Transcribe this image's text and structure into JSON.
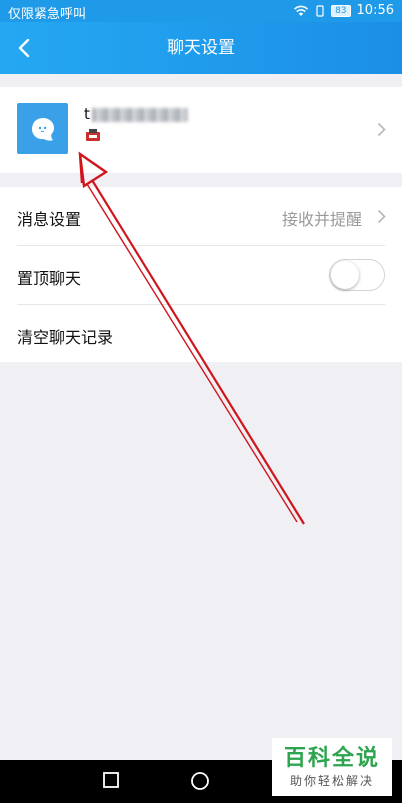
{
  "status_bar": {
    "carrier": "仅限紧急呼叫",
    "battery": "83",
    "time": "10:56"
  },
  "nav": {
    "title": "聊天设置",
    "back_icon": "chevron-left-icon"
  },
  "profile": {
    "name_prefix": "t",
    "avatar_icon": "chat-bubble-icon"
  },
  "settings": {
    "message": {
      "label": "消息设置",
      "value": "接收并提醒"
    },
    "pin": {
      "label": "置顶聊天",
      "on": false
    },
    "clear": {
      "label": "清空聊天记录"
    }
  },
  "watermark": {
    "main": "百科全说",
    "sub": "助你轻松解决"
  },
  "colors": {
    "accent": "#1f9ae8",
    "annotation": "#d0151c"
  }
}
